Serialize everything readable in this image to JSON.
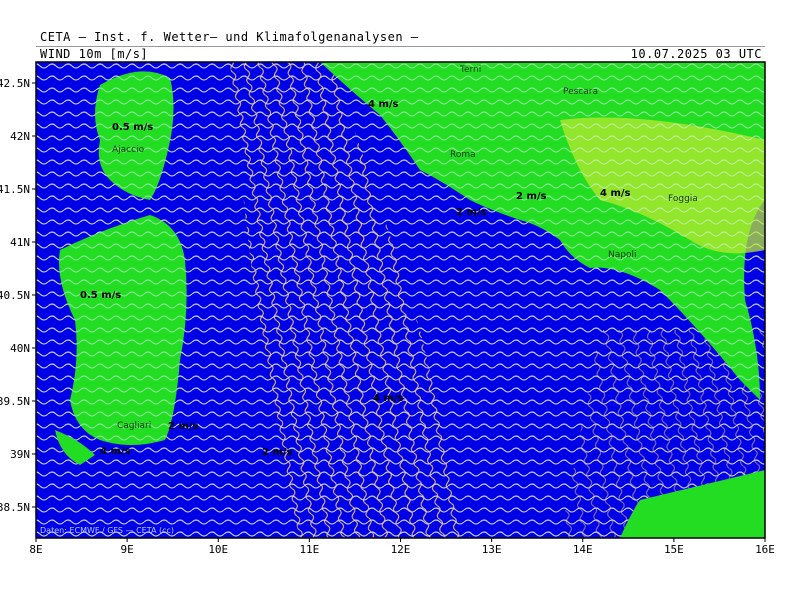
{
  "header": {
    "organization": "CETA — Inst. f. Wetter— und Klimafolgenanalysen —",
    "variable": "WIND 10m [m/s]",
    "timestamp": "10.07.2025 03 UTC"
  },
  "axes": {
    "lon_ticks": [
      "8E",
      "9E",
      "10E",
      "11E",
      "12E",
      "13E",
      "14E",
      "15E",
      "16E"
    ],
    "lat_ticks": [
      "42.5N",
      "42N",
      "41.5N",
      "41N",
      "40.5N",
      "40N",
      "39.5N",
      "39N",
      "38.5N"
    ]
  },
  "places": [
    "Terni",
    "Pescara",
    "Ajaccio",
    "Roma",
    "Foggia",
    "Napoli",
    "Cagliari"
  ],
  "wind_labels": [
    "4 m/s",
    "0.5 m/s",
    "2 m/s",
    "4 m/s",
    "2 m/s",
    "0.5 m/s",
    "2 m/s",
    "4 m/s",
    "4 m/s",
    "2 m/s"
  ],
  "colors": {
    "sea": "#0000e6",
    "land": "#22dd22",
    "strong_land": "#b8e830",
    "streamline_white": "#e8f0ff",
    "streamline_yellow": "#ffd070"
  },
  "credit": "Daten: ECMWF / GFS — CETA (cc)"
}
